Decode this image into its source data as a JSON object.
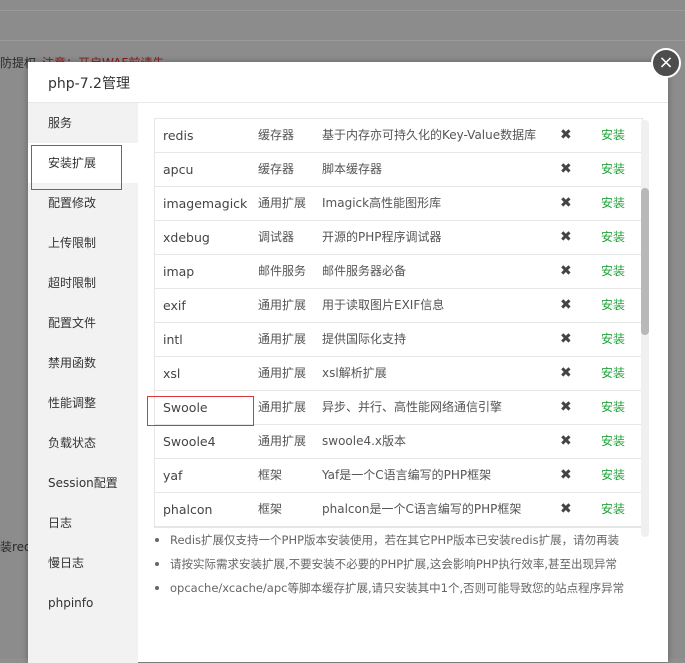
{
  "background": {
    "left_label": "防提权",
    "red_text": "注意：开启WAF前请先...",
    "left_label2": "装red"
  },
  "modal": {
    "title": "php-7.2管理",
    "close_glyph": "×"
  },
  "sidebar": {
    "items": [
      {
        "label": "服务"
      },
      {
        "label": "安装扩展"
      },
      {
        "label": "配置修改"
      },
      {
        "label": "上传限制"
      },
      {
        "label": "超时限制"
      },
      {
        "label": "配置文件"
      },
      {
        "label": "禁用函数"
      },
      {
        "label": "性能调整"
      },
      {
        "label": "负载状态"
      },
      {
        "label": "Session配置"
      },
      {
        "label": "日志"
      },
      {
        "label": "慢日志"
      },
      {
        "label": "phpinfo"
      }
    ]
  },
  "extensions": {
    "rows": [
      {
        "name": "redis",
        "type": "缓存器",
        "desc": "基于内存亦可持久化的Key-Value数据库",
        "status": "✖",
        "action": "安装"
      },
      {
        "name": "apcu",
        "type": "缓存器",
        "desc": "脚本缓存器",
        "status": "✖",
        "action": "安装"
      },
      {
        "name": "imagemagick",
        "type": "通用扩展",
        "desc": "Imagick高性能图形库",
        "status": "✖",
        "action": "安装"
      },
      {
        "name": "xdebug",
        "type": "调试器",
        "desc": "开源的PHP程序调试器",
        "status": "✖",
        "action": "安装"
      },
      {
        "name": "imap",
        "type": "邮件服务",
        "desc": "邮件服务器必备",
        "status": "✖",
        "action": "安装"
      },
      {
        "name": "exif",
        "type": "通用扩展",
        "desc": "用于读取图片EXIF信息",
        "status": "✖",
        "action": "安装"
      },
      {
        "name": "intl",
        "type": "通用扩展",
        "desc": "提供国际化支持",
        "status": "✖",
        "action": "安装"
      },
      {
        "name": "xsl",
        "type": "通用扩展",
        "desc": "xsl解析扩展",
        "status": "✖",
        "action": "安装"
      },
      {
        "name": "Swoole",
        "type": "通用扩展",
        "desc": "异步、并行、高性能网络通信引擎",
        "status": "✖",
        "action": "安装"
      },
      {
        "name": "Swoole4",
        "type": "通用扩展",
        "desc": "swoole4.x版本",
        "status": "✖",
        "action": "安装"
      },
      {
        "name": "yaf",
        "type": "框架",
        "desc": "Yaf是一个C语言编写的PHP框架",
        "status": "✖",
        "action": "安装"
      },
      {
        "name": "phalcon",
        "type": "框架",
        "desc": "phalcon是一个C语言编写的PHP框架",
        "status": "✖",
        "action": "安装"
      }
    ]
  },
  "notes": [
    {
      "text": "Redis扩展仅支持一个PHP版本安装使用，若在其它PHP版本已安装redis扩展，请勿再装"
    },
    {
      "text": "请按实际需求安装扩展,不要安装不必要的PHP扩展,这会影响PHP执行效率,甚至出现异常"
    },
    {
      "text": "opcache/xcache/apc等脚本缓存扩展,请只安装其中1个,否则可能导致您的站点程序异常"
    }
  ],
  "colors": {
    "accent_green": "#20a53a",
    "highlight_red": "#d9363e"
  }
}
